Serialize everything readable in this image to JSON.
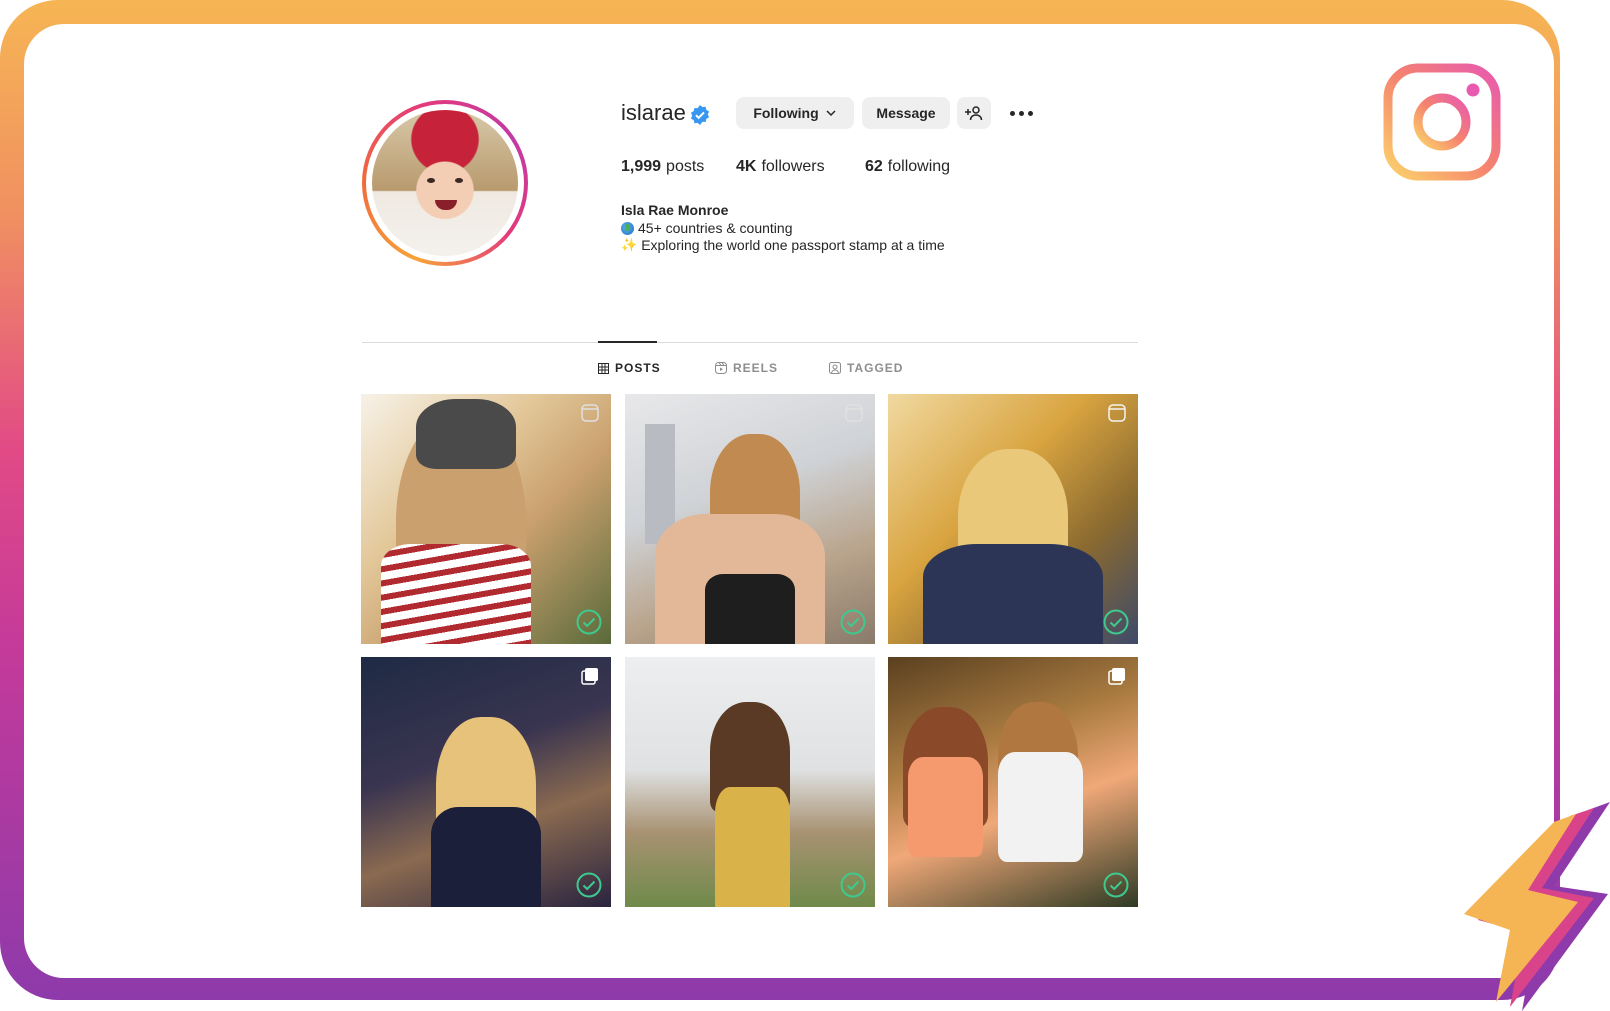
{
  "profile": {
    "username": "islarae",
    "verified": true,
    "buttons": {
      "following": "Following",
      "message": "Message"
    },
    "stats": [
      {
        "value": "1,999",
        "label": "posts"
      },
      {
        "value": "4K",
        "label": "followers"
      },
      {
        "value": "62",
        "label": "following"
      }
    ],
    "bio": {
      "name": "Isla Rae Monroe",
      "lines": [
        "45+ countries & counting",
        "Exploring the world one passport stamp at a time"
      ]
    }
  },
  "tabs": [
    {
      "label": "POSTS",
      "active": true,
      "icon": "grid-icon"
    },
    {
      "label": "REELS",
      "active": false,
      "icon": "reels-icon"
    },
    {
      "label": "TAGGED",
      "active": false,
      "icon": "tagged-icon"
    }
  ],
  "posts": [
    {
      "type": "reel",
      "checked": true
    },
    {
      "type": "reel",
      "checked": true
    },
    {
      "type": "reel",
      "checked": true
    },
    {
      "type": "carousel",
      "checked": true
    },
    {
      "type": "photo",
      "checked": true
    },
    {
      "type": "carousel",
      "checked": true
    }
  ],
  "colors": {
    "check": "#3ec98f",
    "accent_verified": "#3897f0",
    "frame_gradient": [
      "#f6b554",
      "#e24a86",
      "#8e3aab"
    ]
  }
}
